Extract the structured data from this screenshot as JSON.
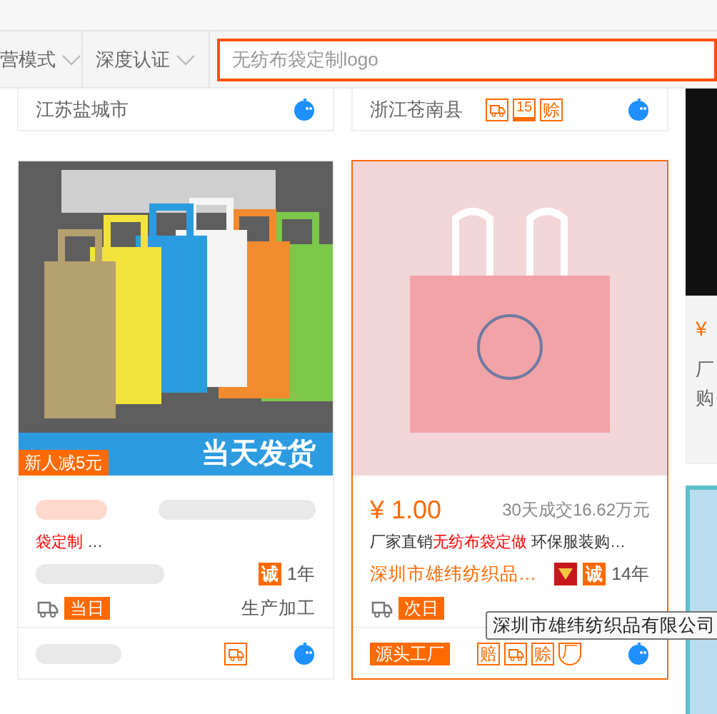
{
  "filters": [
    {
      "label": "营模式"
    },
    {
      "label": "深度认证"
    }
  ],
  "search": {
    "value": "无纺布袋定制logo"
  },
  "top_cards": [
    {
      "location": "江苏盐城市"
    },
    {
      "location": "浙江苍南县",
      "badges": [
        {
          "kind": "truck"
        },
        {
          "kind": "days",
          "text": "15"
        },
        {
          "kind": "text",
          "text": "赊"
        }
      ]
    }
  ],
  "cards": [
    {
      "kind": "bags",
      "hovered": false,
      "promo": "新人减5元",
      "banner": "当天发货",
      "title": [
        {
          "text": "袋定制",
          "highlight": true
        },
        {
          "text": " …",
          "highlight": false
        }
      ],
      "cheng": "诚",
      "years": "1年",
      "delivery": "当日",
      "service": "生产加工",
      "badges": [
        {
          "kind": "truck"
        }
      ]
    },
    {
      "kind": "pink",
      "hovered": true,
      "price": "¥ 1.00",
      "sales": "30天成交16.62万元",
      "title": [
        {
          "text": "厂家直销",
          "highlight": false
        },
        {
          "text": "无纺布袋定做",
          "highlight": true
        },
        {
          "text": " 环保服装购…",
          "highlight": false
        }
      ],
      "company": "深圳市雄纬纺织品…",
      "cheng": "诚",
      "years": "14年",
      "delivery": "次日",
      "tag": "源头工厂",
      "badges": [
        {
          "kind": "text",
          "text": "赔"
        },
        {
          "kind": "truck"
        },
        {
          "kind": "text",
          "text": "赊"
        },
        {
          "kind": "shield",
          "text": "厂"
        }
      ]
    }
  ],
  "side_card": {
    "price": "¥",
    "line_1": "厂",
    "line_2": "购"
  },
  "tooltip": {
    "text": "深圳市雄纬纺织品有限公司"
  }
}
